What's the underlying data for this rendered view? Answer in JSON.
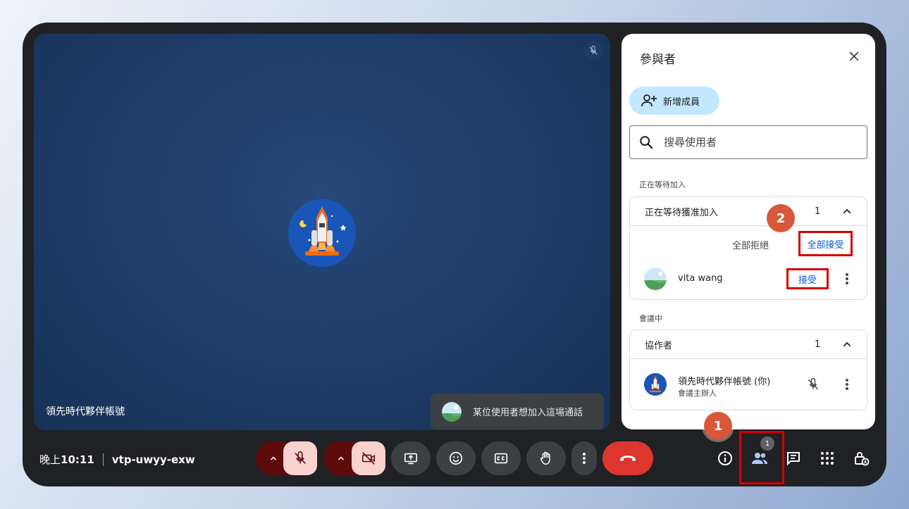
{
  "stage": {
    "participant_name": "領先時代夥伴帳號",
    "toast_text": "某位使用者想加入這場通話"
  },
  "panel": {
    "title": "參與者",
    "add_member_label": "新增成員",
    "search_placeholder": "搜尋使用者",
    "waiting_section_label": "正在等待加入",
    "waiting_group": {
      "title": "正在等待獲准加入",
      "count": "1",
      "deny_all_label": "全部拒絕",
      "accept_all_label": "全部接受",
      "person": {
        "name": "vita wang",
        "accept_label": "接受"
      }
    },
    "in_meeting_section_label": "會議中",
    "collaborator_group": {
      "title": "協作者",
      "count": "1",
      "member": {
        "name": "領先時代夥伴帳號 (你)",
        "role": "會議主辦人"
      }
    }
  },
  "bottom_bar": {
    "time_prefix": "晚上",
    "time": "10:11",
    "meeting_code": "vtp-uwyy-exw",
    "people_badge": "1"
  },
  "annotations": {
    "step1": "1",
    "step2": "2"
  },
  "colors": {
    "accent": "#0b57d0",
    "highlight": "#d50000",
    "end_call": "#dc362e",
    "step_badge": "#d9573a"
  },
  "icons": [
    "mic-off-icon",
    "close-icon",
    "add-person-icon",
    "search-icon",
    "chevron-up-icon",
    "more-vert-icon",
    "camera-off-icon",
    "present-icon",
    "emoji-icon",
    "captions-icon",
    "raise-hand-icon",
    "end-call-icon",
    "info-icon",
    "people-icon",
    "chat-icon",
    "apps-icon",
    "host-controls-icon"
  ]
}
